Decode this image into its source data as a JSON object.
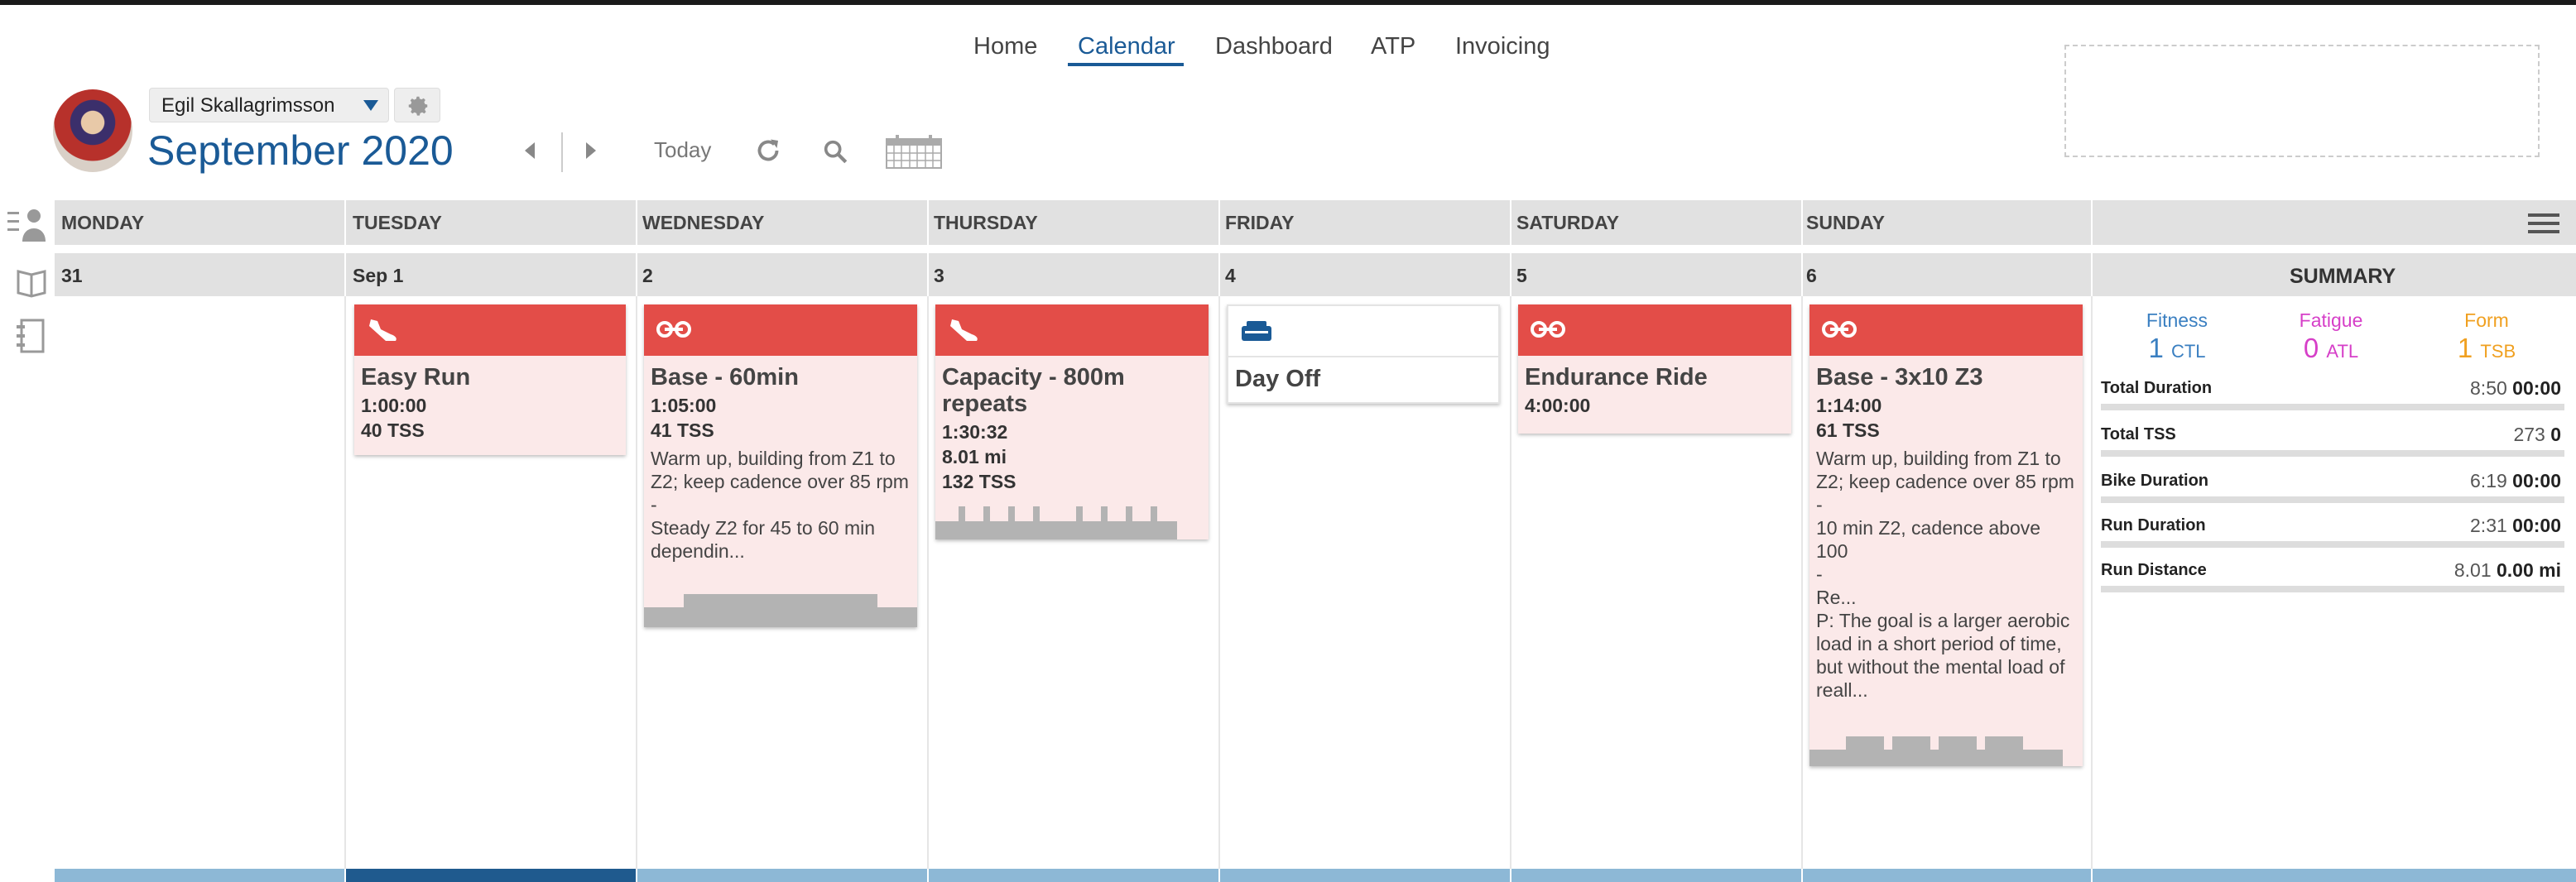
{
  "nav": {
    "items": [
      "Home",
      "Calendar",
      "Dashboard",
      "ATP",
      "Invoicing"
    ],
    "active": "Calendar"
  },
  "header": {
    "athlete": "Egil Skallagrimsson",
    "month": "September",
    "year": "2020",
    "today_label": "Today"
  },
  "days": [
    "MONDAY",
    "TUESDAY",
    "WEDNESDAY",
    "THURSDAY",
    "FRIDAY",
    "SATURDAY",
    "SUNDAY"
  ],
  "dates": [
    "31",
    "Sep 1",
    "2",
    "3",
    "4",
    "5",
    "6"
  ],
  "summary_label": "SUMMARY",
  "workouts": {
    "tue": {
      "title": "Easy Run",
      "duration": "1:00:00",
      "tss": "40 TSS",
      "icon": "run-shoe-icon"
    },
    "wed": {
      "title": "Base - 60min",
      "duration": "1:05:00",
      "tss": "41 TSS",
      "desc1": "Warm up, building from Z1 to Z2; keep cadence over 85 rpm",
      "dash": "-",
      "desc2": "Steady Z2 for 45 to 60 min dependin...",
      "icon": "bike-icon"
    },
    "thu": {
      "title": "Capacity - 800m repeats",
      "duration": "1:30:32",
      "distance": "8.01 mi",
      "tss": "132 TSS",
      "icon": "run-shoe-icon"
    },
    "fri": {
      "title": "Day Off",
      "icon": "sofa-icon"
    },
    "sat": {
      "title": "Endurance Ride",
      "duration": "4:00:00",
      "icon": "bike-icon"
    },
    "sun": {
      "title": "Base - 3x10 Z3",
      "duration": "1:14:00",
      "tss": "61 TSS",
      "desc1": "Warm up, building from Z1 to Z2; keep cadence over 85 rpm",
      "dash1": "-",
      "desc2": "10 min Z2, cadence above 100",
      "dash2": "-",
      "desc3": "Re...",
      "desc4": "P: The goal is a larger aerobic load in a short period of time, but without the mental load of reall...",
      "icon": "bike-icon"
    }
  },
  "summary": {
    "fitness": {
      "label": "Fitness",
      "value": "1",
      "unit": "CTL",
      "color": "#3a7fc1"
    },
    "fatigue": {
      "label": "Fatigue",
      "value": "0",
      "unit": "ATL",
      "color": "#d63fc8"
    },
    "form": {
      "label": "Form",
      "value": "1",
      "unit": "TSB",
      "color": "#f0a020"
    },
    "rows": [
      {
        "label": "Total Duration",
        "planned": "8:50",
        "completed": "00:00"
      },
      {
        "label": "Total TSS",
        "planned": "273",
        "completed": "0"
      },
      {
        "label": "Bike Duration",
        "planned": "6:19",
        "completed": "00:00"
      },
      {
        "label": "Run Duration",
        "planned": "2:31",
        "completed": "00:00"
      },
      {
        "label": "Run Distance",
        "planned": "8.01",
        "completed": "0.00 mi"
      }
    ]
  },
  "colors": {
    "accent": "#1a5a96",
    "card_header": "#e34d48",
    "card_bg": "#fbe9e9"
  }
}
